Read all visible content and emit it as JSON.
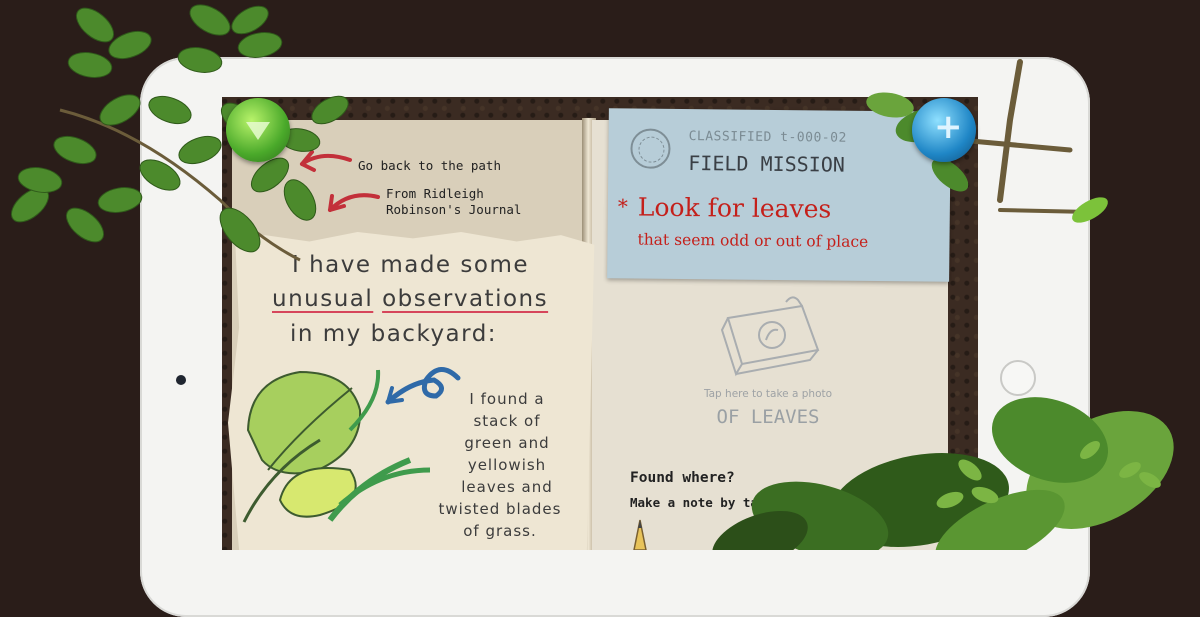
{
  "journal": {
    "nav": {
      "back_label": "Go back to the path",
      "source_label_1": "From Ridleigh",
      "source_label_2": "Robinson's Journal"
    },
    "note": {
      "line1": "I have made some",
      "word_unusual": "unusual",
      "word_observations": "observations",
      "line3": "in my backyard:",
      "found_lines": [
        "I found a",
        "stack of",
        "green and",
        "yellowish",
        "leaves and",
        "twisted blades",
        "of grass."
      ]
    },
    "mission": {
      "code": "CLASSIFIED t-000-02",
      "title": "FIELD MISSION",
      "star": "*",
      "headline": "Look for leaves",
      "subline": "that seem odd or out of place"
    },
    "photo": {
      "hint": "Tap here to take a photo",
      "title": "OF LEAVES"
    },
    "found": {
      "question": "Found where?",
      "instruction": "Make a note by tapping t"
    }
  },
  "colors": {
    "background": "#2a1d19",
    "tablet_frame": "#f4f4f2",
    "mission_card": "#b7cdd8",
    "mission_text": "#c4201b",
    "underline": "#d6465b"
  },
  "icons": [
    "back-arrow-icon",
    "journal-arrow-icon",
    "camera-icon",
    "mission-seal-icon",
    "pencil-icon",
    "plus-icon"
  ]
}
